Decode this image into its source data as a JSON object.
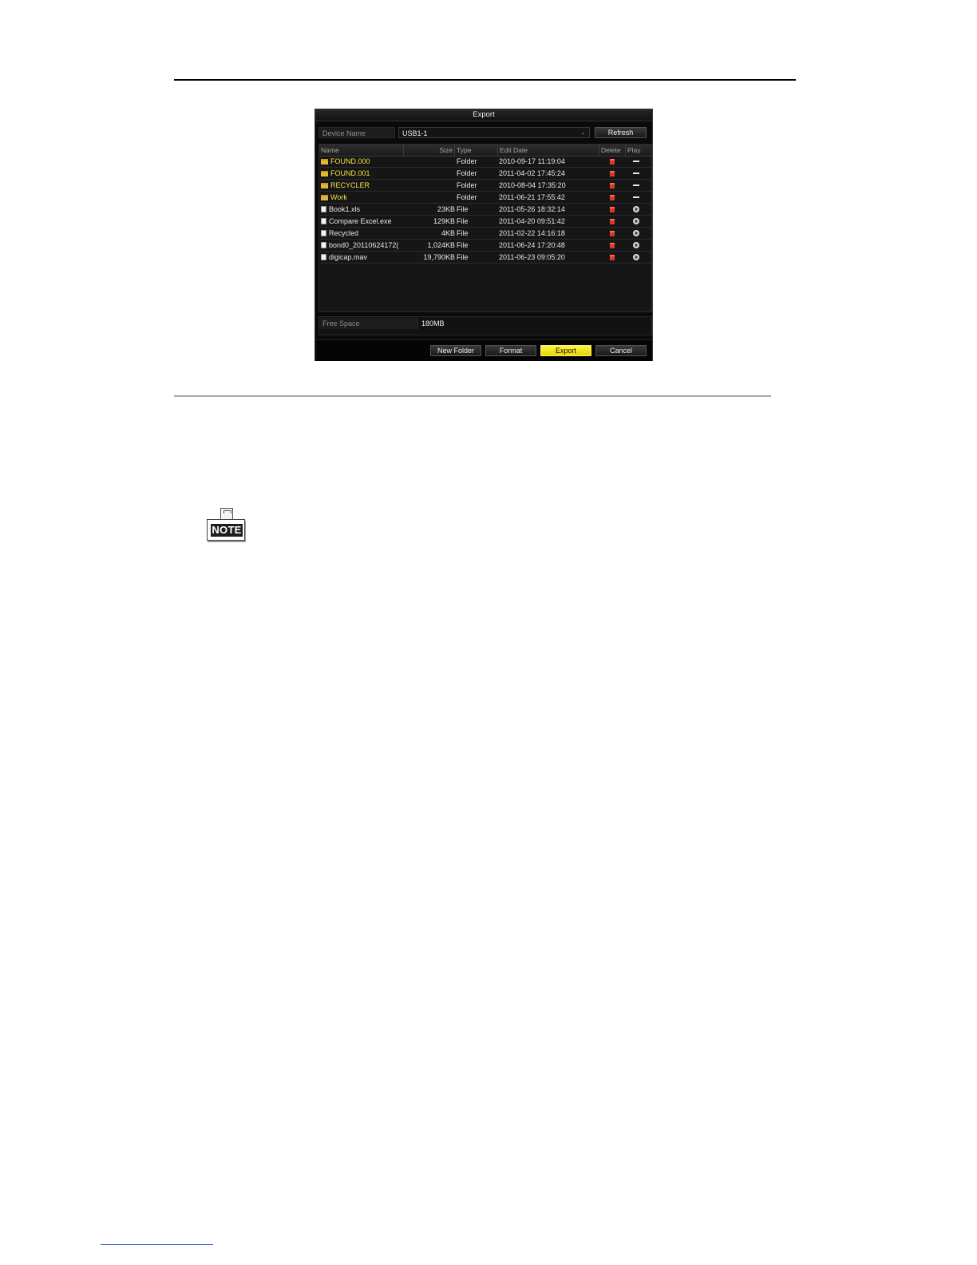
{
  "dialog": {
    "title": "Export",
    "device_label": "Device Name",
    "device_value": "USB1-1",
    "refresh_label": "Refresh",
    "columns": [
      "Name",
      "Size",
      "Type",
      "Edit Date",
      "Delete",
      "Play"
    ],
    "rows": [
      {
        "name": "FOUND.000",
        "size": "",
        "type": "Folder",
        "date": "2010-09-17 11:19:04",
        "kind": "folder"
      },
      {
        "name": "FOUND.001",
        "size": "",
        "type": "Folder",
        "date": "2011-04-02 17:45:24",
        "kind": "folder"
      },
      {
        "name": "RECYCLER",
        "size": "",
        "type": "Folder",
        "date": "2010-08-04 17:35:20",
        "kind": "folder"
      },
      {
        "name": "Work",
        "size": "",
        "type": "Folder",
        "date": "2011-06-21 17:55:42",
        "kind": "folder"
      },
      {
        "name": "Book1.xls",
        "size": "23KB",
        "type": "File",
        "date": "2011-05-26 18:32:14",
        "kind": "file"
      },
      {
        "name": "Compare Excel.exe",
        "size": "129KB",
        "type": "File",
        "date": "2011-04-20 09:51:42",
        "kind": "file"
      },
      {
        "name": "Recycled",
        "size": "4KB",
        "type": "File",
        "date": "2011-02-22 14:16:18",
        "kind": "file"
      },
      {
        "name": "bond0_20110624172(",
        "size": "1,024KB",
        "type": "File",
        "date": "2011-06-24 17:20:48",
        "kind": "file"
      },
      {
        "name": "digicap.mav",
        "size": "19,790KB",
        "type": "File",
        "date": "2011-06-23 09:05:20",
        "kind": "file"
      }
    ],
    "free_space_label": "Free Space",
    "free_space_value": "180MB",
    "buttons": {
      "new_folder": "New Folder",
      "format": "Format",
      "export": "Export",
      "cancel": "Cancel"
    }
  },
  "note": {
    "label": "NOTE"
  },
  "icons": {
    "folder": "folder-icon",
    "file": "file-icon",
    "delete": "trash-icon",
    "play": "play-icon",
    "none": "dash-icon",
    "note": "note-icon"
  },
  "colors": {
    "accent_button": "#f5e600",
    "folder_text": "#f0e23c",
    "dialog_bg": "#0a0a0a"
  }
}
